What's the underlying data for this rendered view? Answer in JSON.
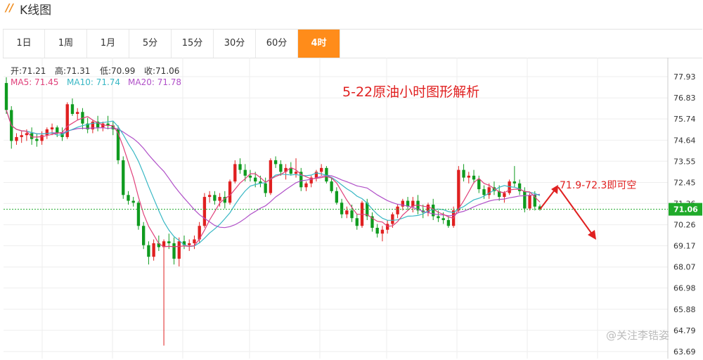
{
  "header": {
    "logo": "//",
    "title": "K线图"
  },
  "tabs": [
    {
      "label": "1日",
      "active": false
    },
    {
      "label": "1周",
      "active": false
    },
    {
      "label": "1月",
      "active": false
    },
    {
      "label": "5分",
      "active": false
    },
    {
      "label": "15分",
      "active": false
    },
    {
      "label": "30分",
      "active": false
    },
    {
      "label": "60分",
      "active": false
    },
    {
      "label": "4时",
      "active": true
    }
  ],
  "colors": {
    "accent": "#ff8c1a",
    "up": "#e02020",
    "down": "#0f9b1f",
    "ma5": "#e0407a",
    "ma10": "#37b7c4",
    "ma20": "#b050c8",
    "annotation": "#e02020"
  },
  "info": {
    "open_label": "开:",
    "open": "71.21",
    "high_label": "高:",
    "high": "71.31",
    "low_label": "低:",
    "low": "70.99",
    "close_label": "收:",
    "close": "71.06",
    "ma5_label": "MA5:",
    "ma5": "71.45",
    "ma10_label": "MA10:",
    "ma10": "71.74",
    "ma20_label": "MA20:",
    "ma20": "71.78"
  },
  "watermark": "@关注李锆姿",
  "chart_data": {
    "type": "candlestick",
    "title": "5-22原油小时图形解析",
    "annotation": "71.9-72.3即可空",
    "current_price": "71.06",
    "yticks": [
      "77.93",
      "76.83",
      "75.74",
      "74.64",
      "73.55",
      "72.45",
      "71.36",
      "70.26",
      "69.17",
      "68.07",
      "66.98",
      "65.88",
      "64.79",
      "63.69"
    ],
    "ylim": [
      63.69,
      78.5
    ],
    "candles": [
      [
        77.6,
        77.9,
        76.0,
        76.2
      ],
      [
        76.2,
        76.4,
        74.2,
        74.6
      ],
      [
        74.6,
        75.0,
        74.4,
        74.8
      ],
      [
        74.8,
        75.1,
        74.5,
        74.9
      ],
      [
        74.9,
        75.2,
        74.6,
        75.0
      ],
      [
        75.0,
        75.3,
        74.4,
        74.7
      ],
      [
        74.7,
        75.0,
        74.3,
        74.6
      ],
      [
        74.6,
        75.1,
        74.4,
        74.9
      ],
      [
        74.9,
        75.3,
        74.7,
        75.2
      ],
      [
        75.2,
        75.5,
        74.9,
        75.3
      ],
      [
        75.3,
        75.4,
        74.8,
        75.0
      ],
      [
        75.0,
        75.3,
        74.6,
        74.8
      ],
      [
        74.8,
        76.6,
        74.7,
        76.5
      ],
      [
        76.5,
        76.8,
        75.9,
        76.0
      ],
      [
        76.0,
        76.3,
        75.7,
        76.1
      ],
      [
        76.1,
        76.3,
        75.2,
        75.5
      ],
      [
        75.5,
        75.8,
        75.0,
        75.2
      ],
      [
        75.2,
        75.7,
        75.0,
        75.6
      ],
      [
        75.6,
        75.9,
        75.1,
        75.3
      ],
      [
        75.3,
        75.6,
        75.1,
        75.5
      ],
      [
        75.5,
        75.9,
        75.2,
        75.4
      ],
      [
        75.4,
        75.6,
        74.9,
        75.2
      ],
      [
        75.2,
        75.4,
        73.4,
        73.6
      ],
      [
        73.6,
        73.8,
        71.6,
        71.8
      ],
      [
        71.8,
        72.0,
        71.3,
        71.5
      ],
      [
        71.5,
        71.7,
        71.2,
        71.4
      ],
      [
        71.4,
        71.5,
        70.0,
        70.2
      ],
      [
        70.2,
        70.4,
        69.0,
        69.2
      ],
      [
        69.2,
        69.4,
        68.2,
        68.6
      ],
      [
        68.6,
        69.5,
        68.4,
        69.3
      ],
      [
        69.3,
        69.7,
        68.9,
        69.1
      ],
      [
        69.1,
        69.5,
        64.0,
        69.4
      ],
      [
        69.4,
        69.8,
        69.0,
        69.3
      ],
      [
        69.3,
        69.6,
        68.2,
        68.5
      ],
      [
        68.5,
        69.6,
        68.1,
        69.4
      ],
      [
        69.4,
        69.7,
        69.0,
        69.2
      ],
      [
        69.2,
        69.5,
        68.9,
        69.3
      ],
      [
        69.3,
        69.7,
        69.0,
        69.5
      ],
      [
        69.5,
        70.4,
        69.3,
        70.2
      ],
      [
        70.2,
        71.9,
        70.1,
        71.7
      ],
      [
        71.7,
        72.0,
        71.4,
        71.8
      ],
      [
        71.8,
        72.0,
        71.3,
        71.5
      ],
      [
        71.5,
        71.9,
        71.2,
        71.7
      ],
      [
        71.7,
        72.0,
        71.1,
        71.4
      ],
      [
        71.4,
        72.6,
        71.3,
        72.5
      ],
      [
        72.5,
        73.6,
        72.4,
        73.4
      ],
      [
        73.4,
        73.7,
        72.9,
        73.1
      ],
      [
        73.1,
        73.4,
        72.5,
        72.8
      ],
      [
        72.8,
        73.1,
        72.5,
        72.7
      ],
      [
        72.7,
        73.0,
        72.2,
        72.5
      ],
      [
        72.5,
        72.8,
        72.2,
        72.4
      ],
      [
        72.4,
        72.7,
        71.7,
        71.9
      ],
      [
        71.9,
        73.7,
        71.8,
        73.6
      ],
      [
        73.6,
        73.8,
        73.2,
        73.4
      ],
      [
        73.4,
        73.6,
        72.8,
        73.0
      ],
      [
        73.0,
        73.4,
        72.6,
        73.2
      ],
      [
        73.2,
        73.5,
        72.8,
        72.9
      ],
      [
        72.9,
        73.7,
        72.7,
        73.0
      ],
      [
        73.0,
        73.2,
        72.0,
        72.2
      ],
      [
        72.2,
        72.5,
        72.0,
        72.4
      ],
      [
        72.4,
        72.8,
        72.2,
        72.7
      ],
      [
        72.7,
        73.1,
        72.5,
        73.0
      ],
      [
        73.0,
        73.4,
        72.8,
        73.2
      ],
      [
        73.2,
        73.3,
        72.4,
        72.5
      ],
      [
        72.5,
        72.7,
        71.9,
        72.0
      ],
      [
        72.0,
        72.2,
        71.3,
        71.4
      ],
      [
        71.4,
        71.6,
        70.6,
        70.8
      ],
      [
        70.8,
        71.2,
        70.6,
        71.0
      ],
      [
        71.0,
        71.3,
        70.4,
        70.6
      ],
      [
        70.6,
        70.8,
        70.0,
        70.2
      ],
      [
        70.2,
        71.5,
        70.1,
        71.4
      ],
      [
        71.4,
        71.6,
        70.5,
        70.7
      ],
      [
        70.7,
        70.9,
        69.9,
        70.1
      ],
      [
        70.1,
        70.3,
        69.6,
        69.8
      ],
      [
        69.8,
        70.2,
        69.4,
        70.0
      ],
      [
        70.0,
        70.5,
        69.8,
        70.3
      ],
      [
        70.3,
        70.9,
        70.1,
        70.8
      ],
      [
        70.8,
        71.3,
        70.6,
        71.2
      ],
      [
        71.2,
        71.6,
        71.0,
        71.5
      ],
      [
        71.5,
        71.7,
        71.0,
        71.2
      ],
      [
        71.2,
        71.7,
        70.9,
        71.5
      ],
      [
        71.5,
        71.8,
        70.8,
        71.0
      ],
      [
        71.0,
        71.3,
        70.6,
        70.9
      ],
      [
        70.9,
        71.4,
        70.7,
        71.3
      ],
      [
        71.3,
        71.6,
        70.5,
        70.7
      ],
      [
        70.7,
        71.0,
        70.4,
        70.6
      ],
      [
        70.6,
        70.9,
        70.3,
        70.5
      ],
      [
        70.5,
        70.7,
        70.1,
        70.2
      ],
      [
        70.2,
        71.2,
        70.1,
        71.0
      ],
      [
        71.0,
        73.3,
        70.9,
        73.1
      ],
      [
        73.1,
        73.4,
        72.5,
        72.7
      ],
      [
        72.7,
        73.0,
        72.4,
        72.8
      ],
      [
        72.8,
        73.1,
        72.4,
        72.6
      ],
      [
        72.6,
        72.8,
        71.9,
        72.1
      ],
      [
        72.1,
        72.3,
        71.6,
        71.8
      ],
      [
        71.8,
        72.4,
        71.6,
        72.2
      ],
      [
        72.2,
        72.5,
        71.8,
        72.0
      ],
      [
        72.0,
        72.3,
        71.5,
        71.7
      ],
      [
        71.7,
        72.0,
        71.4,
        71.9
      ],
      [
        71.9,
        72.6,
        71.8,
        72.5
      ],
      [
        72.5,
        73.3,
        72.2,
        72.4
      ],
      [
        72.4,
        72.6,
        71.8,
        72.0
      ],
      [
        72.0,
        72.2,
        70.9,
        71.1
      ],
      [
        71.1,
        71.9,
        71.0,
        71.8
      ],
      [
        71.8,
        72.0,
        71.0,
        71.2
      ],
      [
        71.21,
        71.31,
        70.99,
        71.06
      ]
    ]
  }
}
